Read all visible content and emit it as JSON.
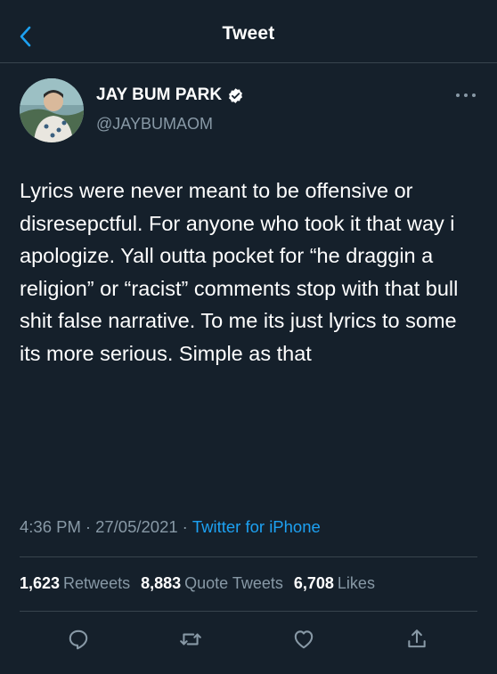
{
  "header": {
    "title": "Tweet",
    "back_icon": "chevron-left-icon"
  },
  "author": {
    "display_name": "JAY BUM PARK",
    "verified_icon": "verified-badge-icon",
    "handle": "@JAYBUMAOM",
    "more_icon": "more-horizontal-icon"
  },
  "tweet": {
    "text": "Lyrics were never meant to be offensive or disresepctful. For anyone who took it that way i apologize. Yall outta pocket for “he draggin a religion” or “racist” comments stop with that bull shit false narrative. To me its just lyrics to some its more serious. Simple as that",
    "time": "4:36 PM",
    "date": "27/05/2021",
    "separator": "·",
    "source": "Twitter for iPhone"
  },
  "stats": {
    "retweets_count": "1,623",
    "retweets_label": "Retweets",
    "quotes_count": "8,883",
    "quotes_label": "Quote Tweets",
    "likes_count": "6,708",
    "likes_label": "Likes"
  },
  "actions": [
    "reply-icon",
    "retweet-icon",
    "like-icon",
    "share-icon"
  ],
  "colors": {
    "background": "#15202b",
    "accent": "#1da1f2",
    "muted": "#8899a6",
    "divider": "#38444d"
  }
}
